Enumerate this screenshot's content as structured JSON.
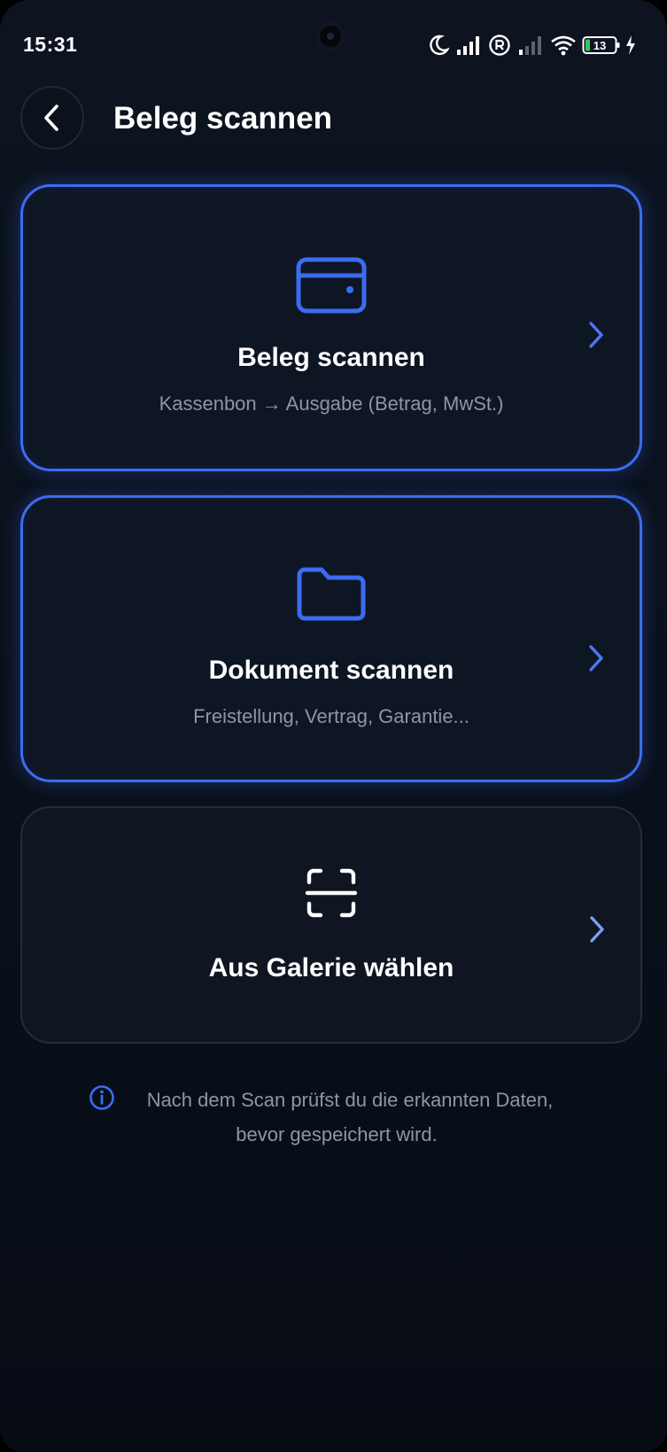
{
  "status_bar": {
    "time": "15:31",
    "battery_level": "13",
    "icons": [
      "moon-icon",
      "signal-icon",
      "roaming-r-icon",
      "signal-weak-icon",
      "wifi-icon",
      "battery-icon",
      "charging-bolt-icon"
    ]
  },
  "header": {
    "title": "Beleg scannen",
    "back_icon": "chevron-left-icon"
  },
  "options": [
    {
      "title": "Beleg scannen",
      "subtitle": "Kassenbon → Ausgabe (Betrag, MwSt.)",
      "icon": "card-icon",
      "highlighted": true
    },
    {
      "title": "Dokument scannen",
      "subtitle": "Freistellung, Vertrag, Garantie...",
      "icon": "folder-icon",
      "highlighted": true
    },
    {
      "title": "Aus Galerie wählen",
      "subtitle": "",
      "icon": "scan-frame-icon",
      "highlighted": false
    }
  ],
  "info": {
    "line1": "Nach dem Scan prüfst du die erkannten Daten,",
    "line2": "bevor gespeichert wird.",
    "icon": "info-icon"
  },
  "colors": {
    "accent": "#3b6cf2",
    "background": "#0a111c",
    "card": "#0e1623",
    "muted_text": "#8d96a6"
  }
}
